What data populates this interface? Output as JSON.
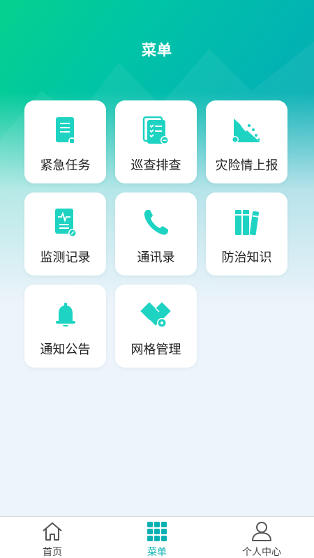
{
  "header": {
    "title": "菜单"
  },
  "menu": {
    "items": [
      {
        "label": "紧急任务",
        "icon": "urgent-task-icon"
      },
      {
        "label": "巡查排查",
        "icon": "inspection-checklist-icon"
      },
      {
        "label": "灾险情上报",
        "icon": "landslide-report-icon"
      },
      {
        "label": "监测记录",
        "icon": "monitoring-record-icon"
      },
      {
        "label": "通讯录",
        "icon": "phone-icon"
      },
      {
        "label": "防治知识",
        "icon": "books-icon"
      },
      {
        "label": "通知公告",
        "icon": "bell-icon"
      },
      {
        "label": "网格管理",
        "icon": "grid-management-icon"
      }
    ]
  },
  "tabbar": {
    "items": [
      {
        "label": "首页",
        "icon": "home-icon",
        "active": false
      },
      {
        "label": "菜单",
        "icon": "menu-grid-icon",
        "active": true
      },
      {
        "label": "个人中心",
        "icon": "user-icon",
        "active": false
      }
    ]
  },
  "colors": {
    "accent": "#0ab1b3",
    "icon": "#1fd3c3",
    "header_start": "#06d18e",
    "header_end": "#0aa5b5"
  }
}
